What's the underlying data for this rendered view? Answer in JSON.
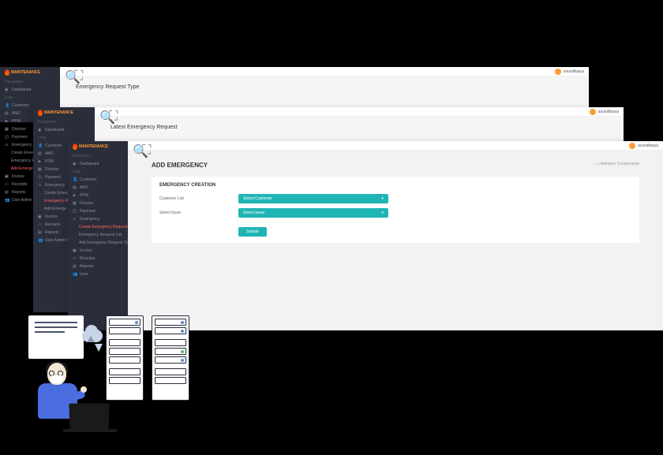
{
  "logo_text": "MAINTENANCE",
  "user_name": "soundharya",
  "nav_heading": "Navigation",
  "lists_heading": "Lists",
  "nav": {
    "dashboard": "Dashboard",
    "customer": "Customer",
    "amc": "AMC",
    "ppm": "PPM",
    "division": "Division",
    "payment": "Payment",
    "emergency": "Emergency",
    "create_emerge": "Create Emerge",
    "emergency_re": "Emergency Re",
    "add_emergenc": "Add Emergenc",
    "add_emerge": "Add Emerge",
    "create_emergency_request": "Create Emergency Request",
    "emergency_request_list": "Emergency Request List",
    "add_emergency_request_type": "Add Emergency Request Type",
    "invoice": "Invoice",
    "receipts": "Receipts",
    "reports": "Reports",
    "user_admin_p": "User Admin P",
    "user_admin_pa": "User Admin Pa",
    "user": "User"
  },
  "page1": {
    "title": "Emergency Request Type"
  },
  "page2": {
    "title": "Latest Emergency Request"
  },
  "page3": {
    "title": "ADD EMERGENCY",
    "breadcrumb_home": "⌂",
    "breadcrumb_sep": "/",
    "breadcrumb_page": "Advance Components",
    "card_title": "EMERGENCY CREATION",
    "customer_label": "Customer List",
    "customer_select": "Select Customer",
    "issue_label": "Select Issue",
    "issue_select": "Select Issue",
    "submit": "Submit"
  }
}
